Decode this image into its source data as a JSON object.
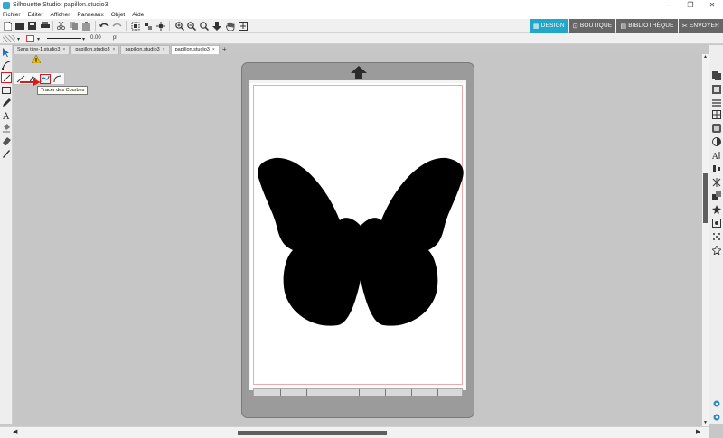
{
  "window": {
    "title": "Silhouette Studio: papillon.studio3",
    "controls": [
      "–",
      "❐",
      "✕"
    ]
  },
  "menu": [
    "Fichier",
    "Editer",
    "Afficher",
    "Panneaux",
    "Objet",
    "Aide"
  ],
  "toolbar": {
    "icons": [
      "new-file-icon",
      "open-folder-icon",
      "save-icon",
      "print-icon",
      "cut-icon",
      "copy-icon",
      "paste-icon",
      "undo-icon",
      "redo-icon",
      "group-icon",
      "ungroup-icon",
      "select-all-icon",
      "release-icon",
      "zoom-in-icon",
      "zoom-out-icon",
      "zoom-fit-icon",
      "move-down-icon",
      "pan-hand-icon",
      "fit-page-icon"
    ]
  },
  "design_tabs": [
    {
      "label": "DESIGN",
      "icon": "design-icon",
      "active": true
    },
    {
      "label": "BOUTIQUE",
      "icon": "store-icon",
      "active": false
    },
    {
      "label": "BIBLIOTHÈQUE",
      "icon": "library-icon",
      "active": false
    },
    {
      "label": "ENVOYER",
      "icon": "send-icon",
      "active": false
    }
  ],
  "properties": {
    "line_width_value": "0.00",
    "line_width_unit": "pt",
    "dropdown_arrow": "▾"
  },
  "documents": [
    {
      "label": "Sans titre-1.studio3",
      "active": false
    },
    {
      "label": "papillon.studio3",
      "active": false
    },
    {
      "label": "papillon.studio3",
      "active": false
    },
    {
      "label": "papillon.studio3",
      "active": true
    }
  ],
  "new_tab_label": "+",
  "tooltip": "Tracer des Courbes",
  "colors": {
    "accent": "#22a7c9",
    "highlight": "#e01818",
    "mat": "#9b9b9b",
    "shape_fill": "#000000"
  }
}
